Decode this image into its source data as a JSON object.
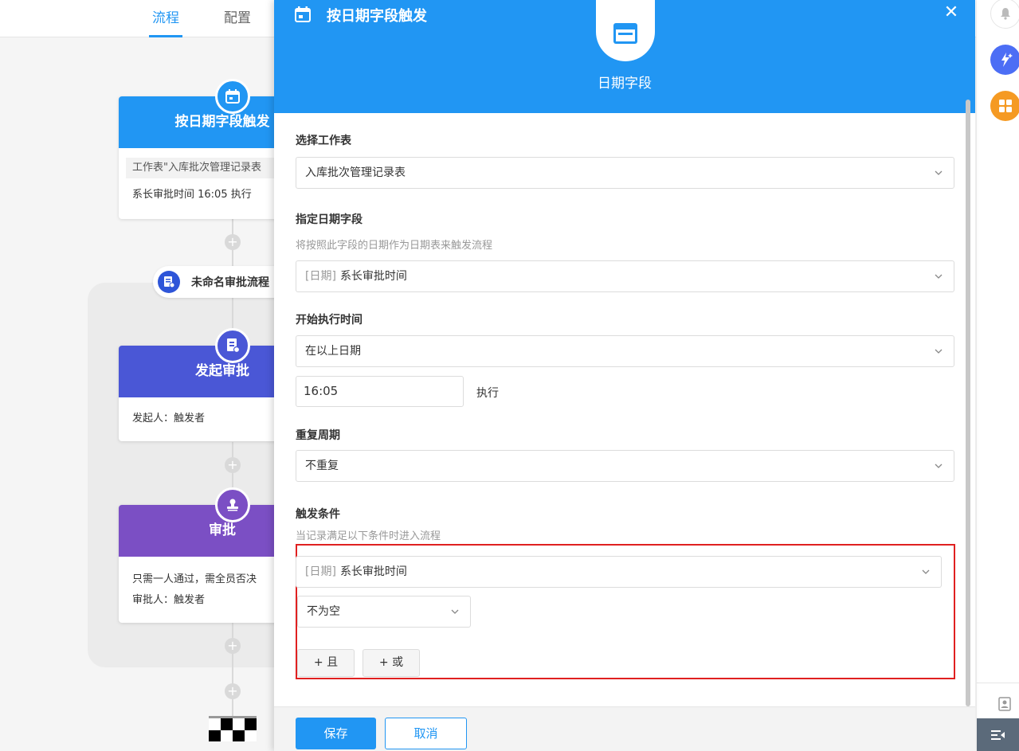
{
  "tabs": {
    "flow": "流程",
    "config": "配置"
  },
  "workflow": {
    "trigger_node": {
      "title": "按日期字段触发",
      "table_text": "工作表\"入库批次管理记录表",
      "schedule_text": "系长审批时间 16:05 执行",
      "icon": "calendar-icon"
    },
    "approval_process": {
      "label": "未命名审批流程",
      "icon": "approval-doc-icon"
    },
    "start_node": {
      "title": "发起审批",
      "body": "发起人：触发者",
      "color": "#4a57d6"
    },
    "approve_node": {
      "title": "审批",
      "rule": "只需一人通过，需全员否决",
      "approver": "审批人：触发者",
      "color": "#7b4fc4"
    },
    "plus_symbol": "+"
  },
  "panel": {
    "title": "按日期字段触发",
    "header_subtitle": "日期字段",
    "close_symbol": "✕",
    "colors": {
      "header": "#2196f3",
      "highlight_border": "#e02020"
    },
    "worksheet": {
      "label": "选择工作表",
      "value": "入库批次管理记录表"
    },
    "date_field": {
      "label": "指定日期字段",
      "hint": "将按照此字段的日期作为日期表来触发流程",
      "type_prefix": "[日期]",
      "value": "系长审批时间"
    },
    "start_time": {
      "label": "开始执行时间",
      "value": "在以上日期",
      "time": "16:05",
      "exec_label": "执行"
    },
    "repeat": {
      "label": "重复周期",
      "value": "不重复"
    },
    "conditions": {
      "label": "触发条件",
      "hint": "当记录满足以下条件时进入流程",
      "field_prefix": "[日期]",
      "field_value": "系长审批时间",
      "operator": "不为空",
      "and_button": "+ 且",
      "or_button": "+ 或"
    },
    "footer": {
      "save": "保存",
      "cancel": "取消"
    }
  }
}
